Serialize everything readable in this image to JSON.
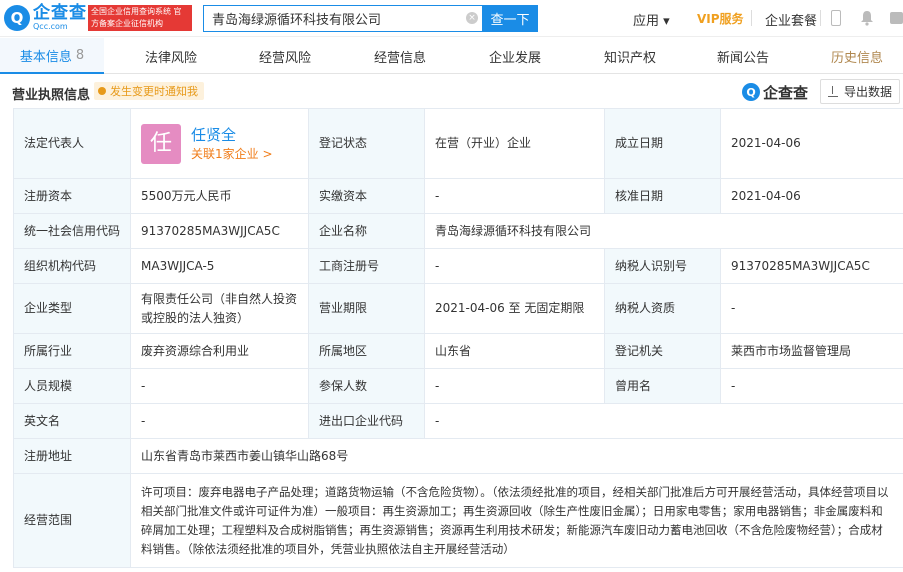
{
  "header": {
    "logo_mark": "Q",
    "logo_name": "企查查",
    "logo_domain": "Qcc.com",
    "slogan": "全国企业信用查询系统 官方备案企业征信机构",
    "search_value": "青岛海绿源循环科技有限公司",
    "search_button": "查一下",
    "app_label": "应用",
    "vip_label": "VIP服务",
    "package_label": "企业套餐"
  },
  "tabs": [
    {
      "label": "基本信息",
      "count": "8"
    },
    {
      "label": "法律风险"
    },
    {
      "label": "经营风险"
    },
    {
      "label": "经营信息"
    },
    {
      "label": "企业发展"
    },
    {
      "label": "知识产权"
    },
    {
      "label": "新闻公告"
    },
    {
      "label": "历史信息"
    }
  ],
  "section": {
    "title": "营业执照信息",
    "badge": "发生变更时通知我",
    "brand_mark": "Q",
    "brand_name": "企查查",
    "export_label": "导出数据"
  },
  "rows": {
    "r1": {
      "l1": "法定代表人",
      "person_avatar": "任",
      "person_name": "任贤全",
      "person_rel": "关联1家企业 >",
      "l2": "登记状态",
      "v2": "在营（开业）企业",
      "l3": "成立日期",
      "v3": "2021-04-06"
    },
    "r2": {
      "l1": "注册资本",
      "v1": "5500万元人民币",
      "l2": "实缴资本",
      "v2": "-",
      "l3": "核准日期",
      "v3": "2021-04-06"
    },
    "r3": {
      "l1": "统一社会信用代码",
      "v1": "91370285MA3WJJCA5C",
      "l2": "企业名称",
      "v2": "青岛海绿源循环科技有限公司"
    },
    "r4": {
      "l1": "组织机构代码",
      "v1": "MA3WJJCA-5",
      "l2": "工商注册号",
      "v2": "-",
      "l3": "纳税人识别号",
      "v3": "91370285MA3WJJCA5C"
    },
    "r5": {
      "l1": "企业类型",
      "v1": "有限责任公司（非自然人投资或控股的法人独资）",
      "l2": "营业期限",
      "v2": "2021-04-06 至 无固定期限",
      "l3": "纳税人资质",
      "v3": "-"
    },
    "r6": {
      "l1": "所属行业",
      "v1": "废弃资源综合利用业",
      "l2": "所属地区",
      "v2": "山东省",
      "l3": "登记机关",
      "v3": "莱西市市场监督管理局"
    },
    "r7": {
      "l1": "人员规模",
      "v1": "-",
      "l2": "参保人数",
      "v2": "-",
      "l3": "曾用名",
      "v3": "-"
    },
    "r8": {
      "l1": "英文名",
      "v1": "-",
      "l2": "进出口企业代码",
      "v2": "-"
    },
    "r9": {
      "l1": "注册地址",
      "v1": "山东省青岛市莱西市姜山镇华山路68号"
    },
    "r10": {
      "l1": "经营范围",
      "v1": "许可项目：废弃电器电子产品处理；道路货物运输（不含危险货物）。（依法须经批准的项目，经相关部门批准后方可开展经营活动，具体经营项目以相关部门批准文件或许可证件为准）一般项目：再生资源加工；再生资源回收（除生产性废旧金属）；日用家电零售；家用电器销售；非金属废料和碎屑加工处理；工程塑料及合成树脂销售；再生资源销售；资源再生利用技术研发；新能源汽车废旧动力蓄电池回收（不含危险废物经营）；合成材料销售。（除依法须经批准的项目外，凭营业执照依法自主开展经营活动）"
    }
  }
}
